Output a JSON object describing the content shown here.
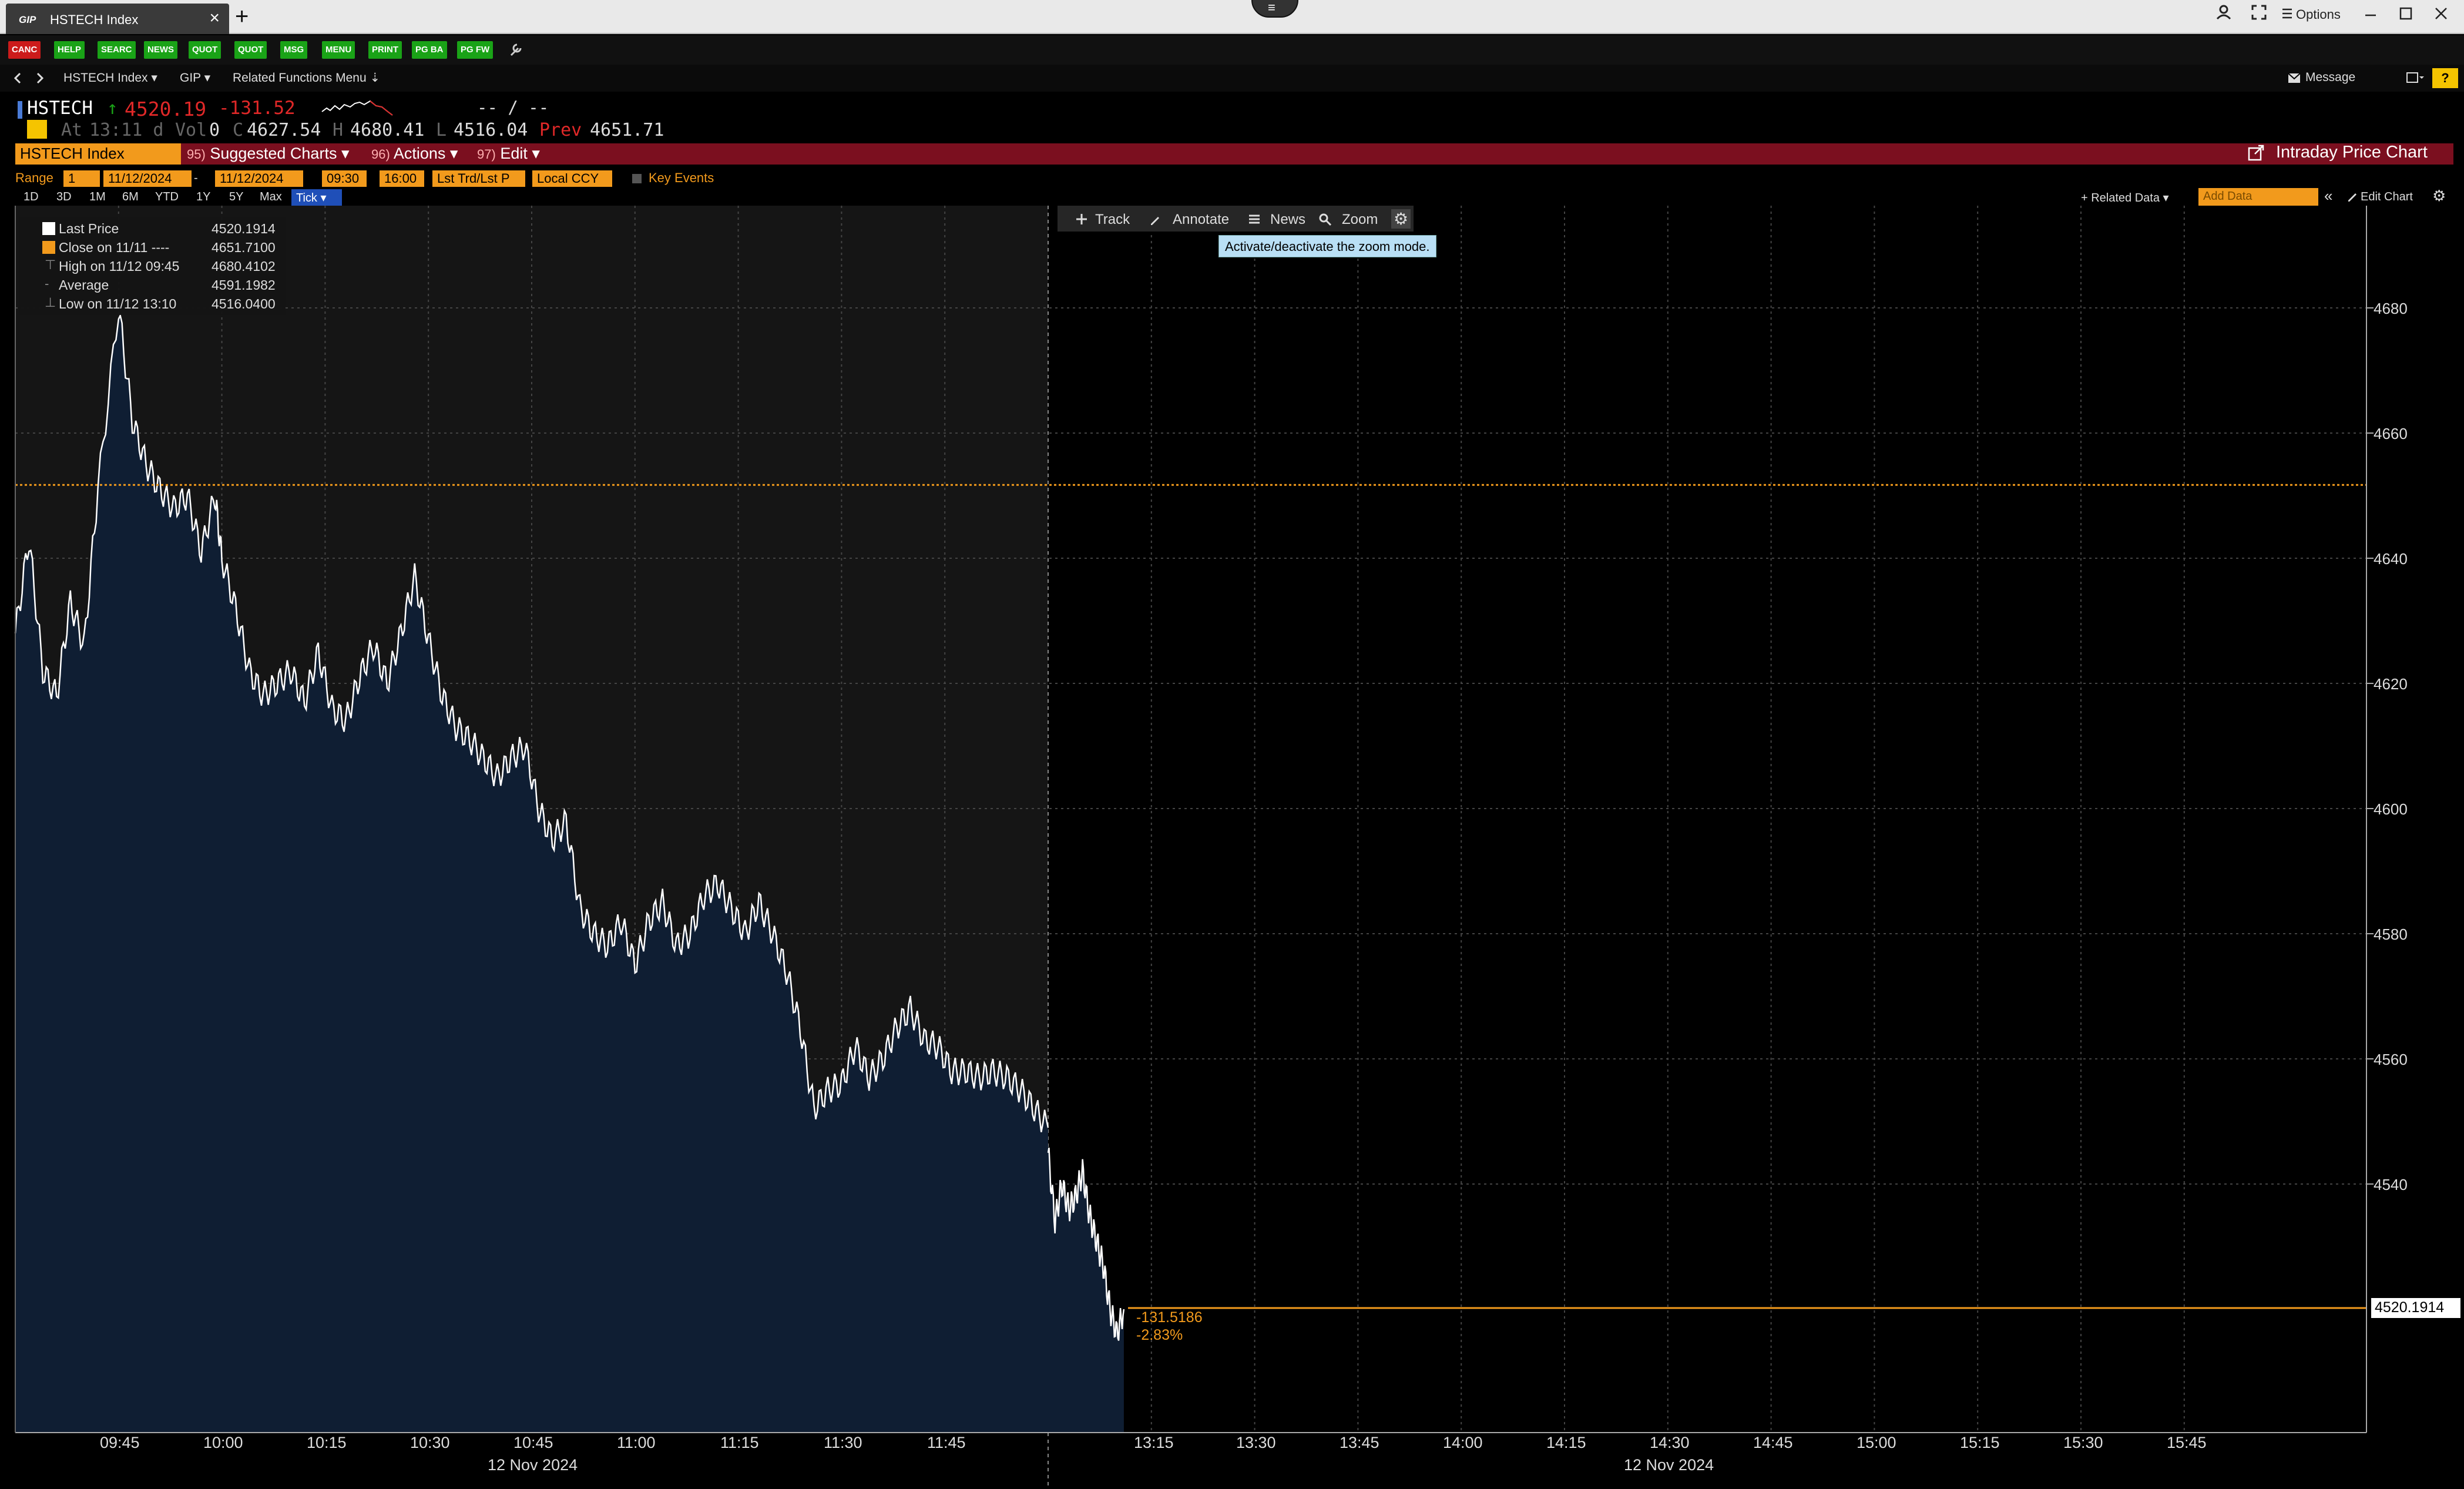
{
  "window": {
    "tab_logo": "GIP",
    "tab_title": "HSTECH Index",
    "tab_close": "×",
    "new_tab": "+",
    "options_label": "Options",
    "menu_glyph": "≡"
  },
  "fkeys": [
    "CANC",
    "HELP",
    "SEARC",
    "NEWS",
    "QUOT",
    "QUOT",
    "MSG",
    "MENU",
    "PRINT",
    "PG BA",
    "PG FW"
  ],
  "navbar": {
    "security": "HSTECH Index ▾",
    "function": "GIP ▾",
    "related": "Related Functions Menu ⇣",
    "message": "Message"
  },
  "quote": {
    "ticker": "HSTECH",
    "arrow": "↑",
    "last": "4520.19",
    "change": "-131.52",
    "bid_ask": "-- / --",
    "at_label": "At",
    "time": "13:11 d",
    "vol_label": "Vol",
    "vol": "0",
    "open_label": "C",
    "open": "4627.54",
    "high_label": "H",
    "high": "4680.41",
    "low_label": "L",
    "low": "4516.04",
    "prev_label": "Prev",
    "prev": "4651.71"
  },
  "commandbar": {
    "security": "HSTECH Index",
    "suggested_num": "95)",
    "suggested": "Suggested Charts",
    "actions_num": "96)",
    "actions": "Actions",
    "edit_num": "97)",
    "edit": "Edit",
    "title": "Intraday Price Chart"
  },
  "range": {
    "label": "Range",
    "count": "1",
    "start_date": "11/12/2024",
    "end_date": "11/12/2024",
    "start_time": "09:30",
    "end_time": "16:00",
    "field": "Lst Trd/Lst P",
    "currency": "Local CCY",
    "key_events": "Key Events"
  },
  "periods": [
    "1D",
    "3D",
    "1M",
    "6M",
    "YTD",
    "1Y",
    "5Y",
    "Max"
  ],
  "tick": "Tick ▾",
  "right_controls": {
    "related_data": "+ Related Data ▾",
    "add_data": "Add Data",
    "collapse": "«",
    "edit_chart": "Edit Chart",
    "gear": "⚙"
  },
  "tools": {
    "track": "Track",
    "annotate": "Annotate",
    "news": "News",
    "zoom": "Zoom",
    "tooltip": "Activate/deactivate the zoom mode."
  },
  "legend": [
    {
      "label": "Last Price",
      "value": "4520.1914"
    },
    {
      "label": "Close on 11/11 ----",
      "value": "4651.7100"
    },
    {
      "label": "High on 11/12 09:45",
      "value": "4680.4102"
    },
    {
      "label": "Average",
      "value": "4591.1982"
    },
    {
      "label": "Low on 11/12 13:10",
      "value": "4516.0400"
    }
  ],
  "colors": {
    "background": "#000000",
    "morning_session_bg": "#151515",
    "area_fill": "#0f1e33",
    "line": "#ffffff",
    "prev_close": "#f29a1c",
    "up": "#1aa317",
    "down": "#e02828",
    "accent": "#f29a1c"
  },
  "chart_data": {
    "type": "area",
    "title": "Intraday Price Chart",
    "y_ticks": [
      "4680",
      "4660",
      "4640",
      "4620",
      "4600",
      "4580",
      "4560",
      "4540"
    ],
    "ylim": [
      4470,
      4690
    ],
    "x_ticks": [
      "09:45",
      "10:00",
      "10:15",
      "10:30",
      "10:45",
      "11:00",
      "11:15",
      "11:30",
      "11:45",
      "13:15",
      "13:30",
      "13:45",
      "14:00",
      "14:15",
      "14:30",
      "14:45",
      "15:00",
      "15:15",
      "15:30",
      "15:45"
    ],
    "date_labels": [
      "12 Nov 2024",
      "12 Nov 2024"
    ],
    "prev_close": 4651.71,
    "last_price_label": "4520.1914",
    "change_label": "-131.5186",
    "change_pct_label": "-2.83%",
    "session1": [
      [
        "09:30",
        4628
      ],
      [
        "09:32",
        4643
      ],
      [
        "09:34",
        4622
      ],
      [
        "09:36",
        4618
      ],
      [
        "09:38",
        4633
      ],
      [
        "09:40",
        4626
      ],
      [
        "09:42",
        4651
      ],
      [
        "09:45",
        4680
      ],
      [
        "09:47",
        4662
      ],
      [
        "09:49",
        4655
      ],
      [
        "09:51",
        4651
      ],
      [
        "09:53",
        4648
      ],
      [
        "09:55",
        4650
      ],
      [
        "09:57",
        4641
      ],
      [
        "09:59",
        4650
      ],
      [
        "10:00",
        4640
      ],
      [
        "10:02",
        4632
      ],
      [
        "10:04",
        4622
      ],
      [
        "10:06",
        4618
      ],
      [
        "10:08",
        4620
      ],
      [
        "10:10",
        4622
      ],
      [
        "10:12",
        4617
      ],
      [
        "10:14",
        4625
      ],
      [
        "10:16",
        4616
      ],
      [
        "10:18",
        4614
      ],
      [
        "10:20",
        4621
      ],
      [
        "10:22",
        4626
      ],
      [
        "10:24",
        4620
      ],
      [
        "10:26",
        4628
      ],
      [
        "10:28",
        4637
      ],
      [
        "10:30",
        4627
      ],
      [
        "10:32",
        4618
      ],
      [
        "10:34",
        4613
      ],
      [
        "10:36",
        4611
      ],
      [
        "10:38",
        4608
      ],
      [
        "10:40",
        4605
      ],
      [
        "10:42",
        4608
      ],
      [
        "10:44",
        4610
      ],
      [
        "10:46",
        4600
      ],
      [
        "10:48",
        4595
      ],
      [
        "10:50",
        4598
      ],
      [
        "10:52",
        4584
      ],
      [
        "10:54",
        4580
      ],
      [
        "10:56",
        4578
      ],
      [
        "10:58",
        4582
      ],
      [
        "11:00",
        4575
      ],
      [
        "11:02",
        4582
      ],
      [
        "11:04",
        4585
      ],
      [
        "11:06",
        4578
      ],
      [
        "11:08",
        4580
      ],
      [
        "11:10",
        4586
      ],
      [
        "11:12",
        4588
      ],
      [
        "11:14",
        4584
      ],
      [
        "11:16",
        4580
      ],
      [
        "11:18",
        4585
      ],
      [
        "11:20",
        4580
      ],
      [
        "11:22",
        4574
      ],
      [
        "11:24",
        4565
      ],
      [
        "11:26",
        4552
      ],
      [
        "11:28",
        4555
      ],
      [
        "11:30",
        4556
      ],
      [
        "11:32",
        4562
      ],
      [
        "11:34",
        4557
      ],
      [
        "11:36",
        4560
      ],
      [
        "11:38",
        4565
      ],
      [
        "11:40",
        4568
      ],
      [
        "11:42",
        4563
      ],
      [
        "11:44",
        4562
      ],
      [
        "11:46",
        4558
      ],
      [
        "11:48",
        4558
      ],
      [
        "11:50",
        4557
      ],
      [
        "11:52",
        4558
      ],
      [
        "11:54",
        4557
      ],
      [
        "11:56",
        4555
      ],
      [
        "11:58",
        4552
      ],
      [
        "12:00",
        4549
      ]
    ],
    "session2": [
      [
        "13:00",
        4545
      ],
      [
        "13:01",
        4534
      ],
      [
        "13:02",
        4540
      ],
      [
        "13:03",
        4536
      ],
      [
        "13:04",
        4538
      ],
      [
        "13:05",
        4542
      ],
      [
        "13:06",
        4535
      ],
      [
        "13:07",
        4531
      ],
      [
        "13:08",
        4527
      ],
      [
        "13:09",
        4520
      ],
      [
        "13:10",
        4516
      ],
      [
        "13:11",
        4520
      ]
    ]
  }
}
